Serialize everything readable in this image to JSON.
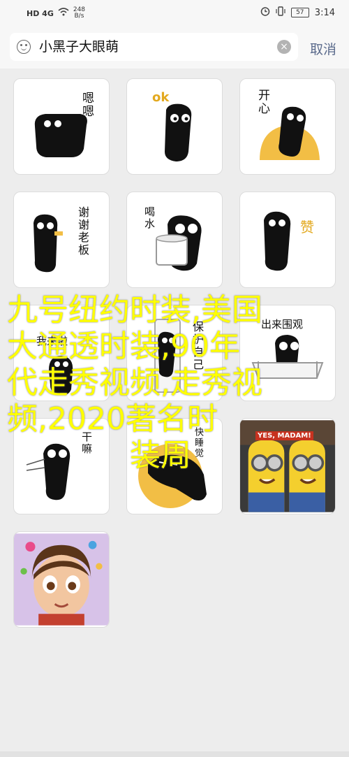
{
  "status_bar": {
    "signal": "HD 4G",
    "speed_value": "248",
    "speed_unit": "B/s",
    "battery": "57",
    "time": "3:14"
  },
  "search": {
    "query": "小黑子大眼萌",
    "cancel_label": "取消"
  },
  "stickers": [
    {
      "caption": "嗯嗯",
      "icon": "blob-sticker-icon"
    },
    {
      "caption": "ok",
      "icon": "blob-sticker-icon"
    },
    {
      "caption": "开心",
      "icon": "blob-sticker-icon"
    },
    {
      "caption": "谢谢老板",
      "icon": "blob-sticker-icon"
    },
    {
      "caption": "喝水",
      "icon": "blob-sticker-icon"
    },
    {
      "caption": "赞",
      "icon": "blob-sticker-icon"
    },
    {
      "caption": "我来啦",
      "icon": "blob-sticker-icon"
    },
    {
      "caption": "保护自己",
      "icon": "blob-sticker-icon"
    },
    {
      "caption": "出来围观",
      "icon": "blob-sticker-icon"
    },
    {
      "caption": "干嘛",
      "icon": "blob-sticker-icon"
    },
    {
      "caption": "快睡觉",
      "icon": "blob-sticker-icon"
    },
    {
      "caption": "YES, MADAM!",
      "icon": "minions-photo"
    },
    {
      "caption": "",
      "icon": "cartoon-girl-photo"
    }
  ],
  "overlay": {
    "line1": "九号纽约时装,美国",
    "line2": "大通透时装,90年",
    "line3": "代走秀视频,走秀视",
    "line4": "频,2020著名时",
    "line5": "装周"
  },
  "colors": {
    "accent_yellow": "#f2be45",
    "overlay_text": "#ffff00",
    "cancel_blue": "#5b6b8c"
  }
}
